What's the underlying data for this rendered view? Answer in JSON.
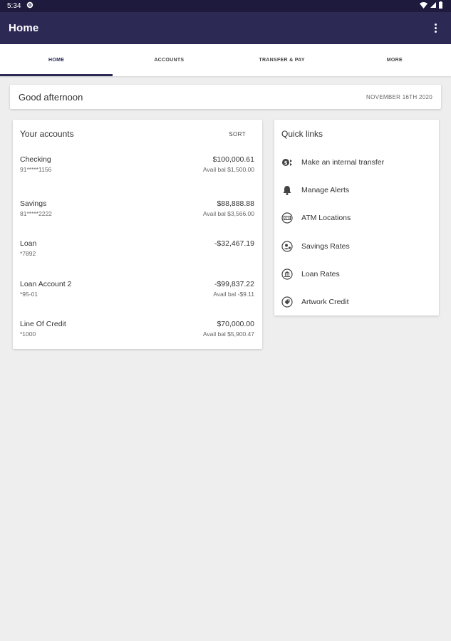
{
  "status_bar": {
    "time": "5:34"
  },
  "app_bar": {
    "title": "Home"
  },
  "tabs": [
    {
      "label": "HOME",
      "active": true
    },
    {
      "label": "ACCOUNTS",
      "active": false
    },
    {
      "label": "TRANSFER & PAY",
      "active": false
    },
    {
      "label": "MORE",
      "active": false
    }
  ],
  "greeting": {
    "text": "Good afternoon",
    "date": "NOVEMBER 16TH 2020"
  },
  "accounts": {
    "title": "Your accounts",
    "sort_label": "SORT",
    "items": [
      {
        "name": "Checking",
        "number": "91*****1156",
        "balance": "$100,000.61",
        "avail": "Avail bal $1,500.00"
      },
      {
        "name": "Savings",
        "number": "81*****2222",
        "balance": "$88,888.88",
        "avail": "Avail bal $3,566.00"
      },
      {
        "name": "Loan",
        "number": "*7892",
        "balance": "-$32,467.19",
        "avail": ""
      },
      {
        "name": "Loan Account 2",
        "number": "*95-01",
        "balance": "-$99,837.22",
        "avail": "Avail bal -$9.11"
      },
      {
        "name": "Line Of Credit",
        "number": "*1000",
        "balance": "$70,000.00",
        "avail": "Avail bal $5,900.47"
      }
    ]
  },
  "quick_links": {
    "title": "Quick links",
    "items": [
      {
        "label": "Make an internal transfer",
        "icon": "transfer-icon"
      },
      {
        "label": "Manage Alerts",
        "icon": "bell-icon"
      },
      {
        "label": "ATM Locations",
        "icon": "atm-icon"
      },
      {
        "label": "Savings Rates",
        "icon": "savings-icon"
      },
      {
        "label": "Loan Rates",
        "icon": "bank-icon"
      },
      {
        "label": "Artwork Credit",
        "icon": "tag-icon"
      }
    ]
  },
  "colors": {
    "primary": "#2c2955",
    "status_bar": "#1d1a3d",
    "background": "#eeeeee"
  }
}
